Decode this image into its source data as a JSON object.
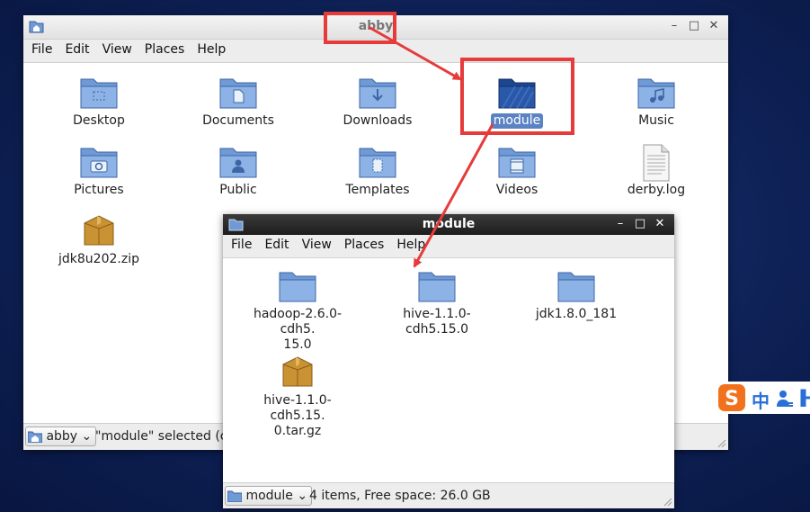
{
  "main_window": {
    "title": "abby",
    "menu": [
      "File",
      "Edit",
      "View",
      "Places",
      "Help"
    ],
    "items": [
      {
        "label": "Desktop",
        "icon": "folder-desktop-icon"
      },
      {
        "label": "Documents",
        "icon": "folder-documents-icon"
      },
      {
        "label": "Downloads",
        "icon": "folder-downloads-icon"
      },
      {
        "label": "module",
        "icon": "folder-icon",
        "selected": true
      },
      {
        "label": "Music",
        "icon": "folder-music-icon"
      },
      {
        "label": "Pictures",
        "icon": "folder-pictures-icon"
      },
      {
        "label": "Public",
        "icon": "folder-public-icon"
      },
      {
        "label": "Templates",
        "icon": "folder-templates-icon"
      },
      {
        "label": "Videos",
        "icon": "folder-videos-icon"
      },
      {
        "label": "derby.log",
        "icon": "text-file-icon"
      },
      {
        "label": "jdk8u202.zip",
        "icon": "archive-icon"
      }
    ],
    "status": {
      "location": "abby",
      "text": "\"module\" selected (co"
    }
  },
  "module_window": {
    "title": "module",
    "menu": [
      "File",
      "Edit",
      "View",
      "Places",
      "Help"
    ],
    "items": [
      {
        "label_line1": "hadoop-2.6.0-cdh5.",
        "label_line2": "15.0",
        "icon": "folder-icon"
      },
      {
        "label_line1": "hive-1.1.0-cdh5.15.0",
        "icon": "folder-icon"
      },
      {
        "label_line1": "jdk1.8.0_181",
        "icon": "folder-icon"
      },
      {
        "label_line1": "hive-1.1.0-cdh5.15.",
        "label_line2": "0.tar.gz",
        "icon": "archive-icon"
      }
    ],
    "status": {
      "location": "module",
      "text": "4 items, Free space: 26.0 GB"
    }
  },
  "ime": {
    "glyph": "中"
  },
  "colors": {
    "annotation": "#e63b3b",
    "selection": "#5b83c4",
    "folder": "#6f9ad6"
  }
}
